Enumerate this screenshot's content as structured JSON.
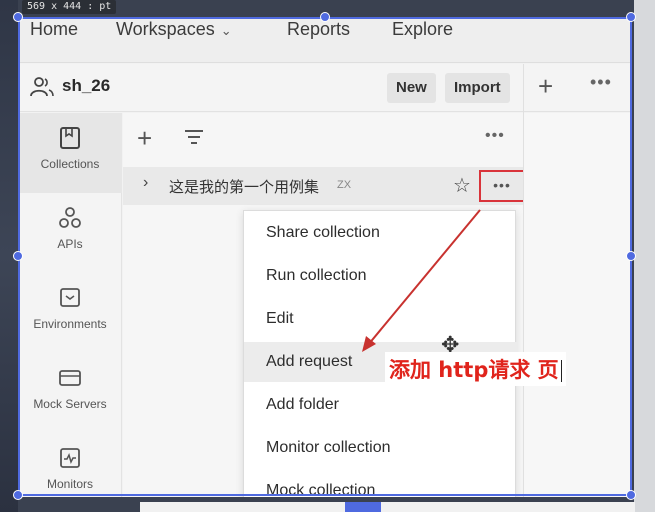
{
  "overlay": {
    "dimension_tag": "569 x 444 : pt"
  },
  "topnav": {
    "home": "Home",
    "workspaces": "Workspaces",
    "reports": "Reports",
    "explore": "Explore"
  },
  "workspace": {
    "name": "sh_26",
    "new_label": "New",
    "import_label": "Import"
  },
  "sidebar": {
    "items": [
      {
        "label": "Collections",
        "icon": "collections-icon",
        "active": true
      },
      {
        "label": "APIs",
        "icon": "apis-icon",
        "active": false
      },
      {
        "label": "Environments",
        "icon": "environments-icon",
        "active": false
      },
      {
        "label": "Mock Servers",
        "icon": "mock-servers-icon",
        "active": false
      },
      {
        "label": "Monitors",
        "icon": "monitors-icon",
        "active": false
      }
    ]
  },
  "collection": {
    "name": "这是我的第一个用例集",
    "badge": "ZX"
  },
  "menu": {
    "items": [
      {
        "label": "Share collection"
      },
      {
        "label": "Run collection"
      },
      {
        "label": "Edit"
      },
      {
        "label": "Add request"
      },
      {
        "label": "Add folder"
      },
      {
        "label": "Monitor collection"
      },
      {
        "label": "Mock collection"
      }
    ]
  },
  "annotation": {
    "text": "添加 http请求 页"
  },
  "colors": {
    "annotation_red": "#e0241c",
    "selection_blue": "#4f6ae0",
    "highlight_box": "#d9333a"
  }
}
